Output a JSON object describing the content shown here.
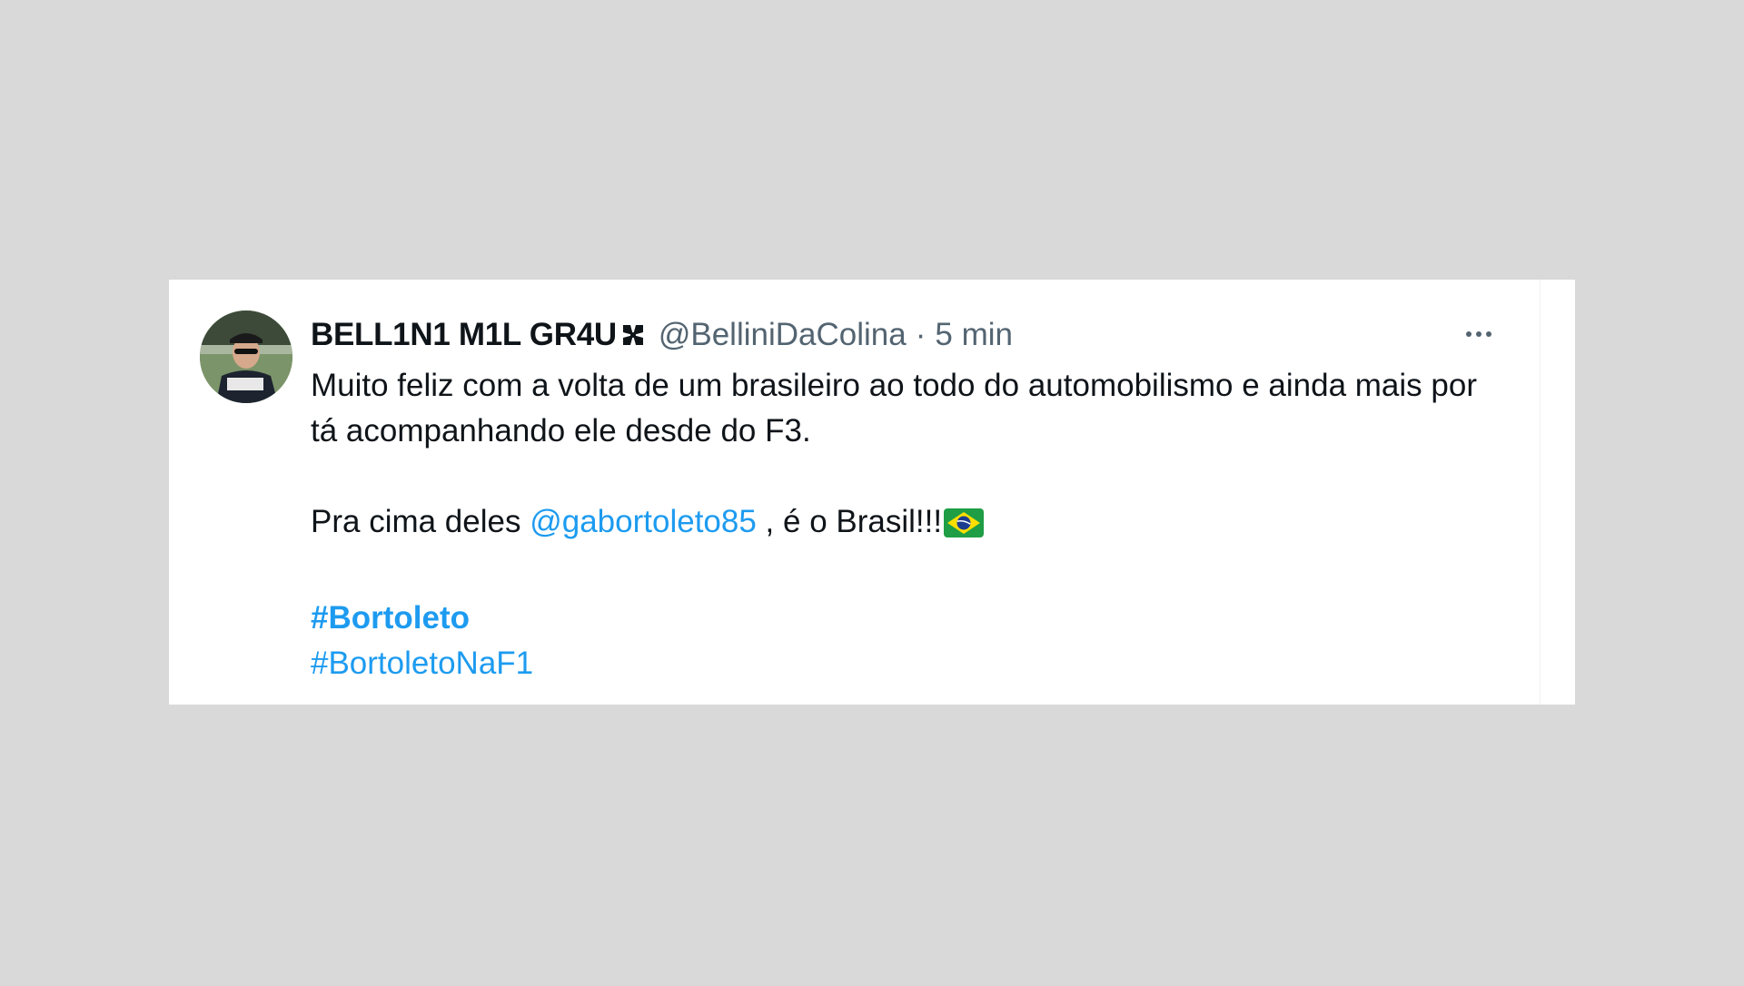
{
  "tweet": {
    "display_name": "BELL1N1 M1L GR4U",
    "display_name_emoji": "maltese-cross-icon",
    "handle": "@BelliniDaColina",
    "separator": "·",
    "timestamp": "5 min",
    "more_icon": "more-options-icon",
    "text_line_1": "Muito feliz com a volta de um brasileiro ao todo do automobilismo e ainda mais por tá acompanhando ele desde do F3.",
    "text_line_2_prefix": "Pra cima deles ",
    "mention": "@gabortoleto85",
    "text_line_2_suffix": " , é o Brasil!!!",
    "flag_emoji": "brazil-flag-icon",
    "hashtag_1": "#Bortoleto",
    "hashtag_2": "#BortoletoNaF1"
  },
  "colors": {
    "background": "#d9d9d9",
    "card": "#ffffff",
    "text": "#0f1419",
    "secondary_text": "#536471",
    "link": "#1d9bf0"
  }
}
